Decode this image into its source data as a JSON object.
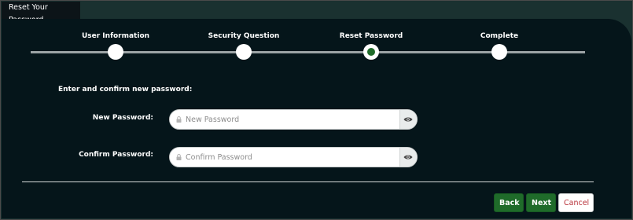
{
  "tab": {
    "title": "Reset Your Password"
  },
  "steps": [
    {
      "label": "User Information",
      "state": "done"
    },
    {
      "label": "Security Question",
      "state": "done"
    },
    {
      "label": "Reset Password",
      "state": "active"
    },
    {
      "label": "Complete",
      "state": "pending"
    }
  ],
  "form": {
    "instructions": "Enter and confirm new password:",
    "new_password": {
      "label": "New Password:",
      "placeholder": "New Password",
      "value": ""
    },
    "confirm_password": {
      "label": "Confirm Password:",
      "placeholder": "Confirm Password",
      "value": ""
    }
  },
  "buttons": {
    "back": "Back",
    "next": "Next",
    "cancel": "Cancel"
  },
  "icons": {
    "field_prefix": "lock-icon",
    "visibility_toggle": "eye-icon"
  },
  "colors": {
    "accent_green": "#1f6b2a",
    "panel_dark": "#05151a",
    "cancel_text": "#b8323a"
  }
}
